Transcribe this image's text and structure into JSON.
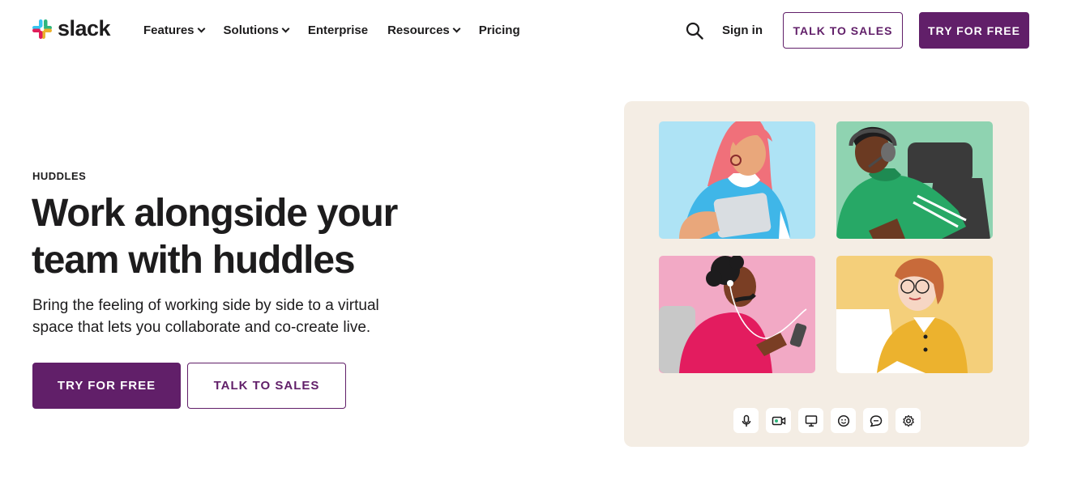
{
  "brand": {
    "name": "slack"
  },
  "nav": {
    "items": [
      {
        "label": "Features",
        "dropdown": true
      },
      {
        "label": "Solutions",
        "dropdown": true
      },
      {
        "label": "Enterprise",
        "dropdown": false
      },
      {
        "label": "Resources",
        "dropdown": true
      },
      {
        "label": "Pricing",
        "dropdown": false
      }
    ],
    "search_icon": "search-icon",
    "sign_in": "Sign in",
    "talk_to_sales": "TALK TO SALES",
    "try_for_free": "TRY FOR FREE"
  },
  "hero": {
    "eyebrow": "HUDDLES",
    "headline": "Work alongside your team with huddles",
    "subtext": "Bring the feeling of working side by side to a virtual space that lets you collaborate and co-create live.",
    "primary_cta": "TRY FOR FREE",
    "secondary_cta": "TALK TO SALES"
  },
  "illustration": {
    "tiles": [
      {
        "name": "person-tablet",
        "bg": "#aee3f5"
      },
      {
        "name": "person-headset",
        "bg": "#8fd3b1"
      },
      {
        "name": "person-phone",
        "bg": "#f2a9c5"
      },
      {
        "name": "person-glasses",
        "bg": "#f4cf7a"
      }
    ],
    "controls": [
      "microphone-icon",
      "video-icon",
      "screen-share-icon",
      "emoji-icon",
      "chat-icon",
      "settings-icon"
    ]
  },
  "colors": {
    "aubergine": "#611f69",
    "text": "#1d1c1d",
    "card_bg": "#f4ede4"
  }
}
